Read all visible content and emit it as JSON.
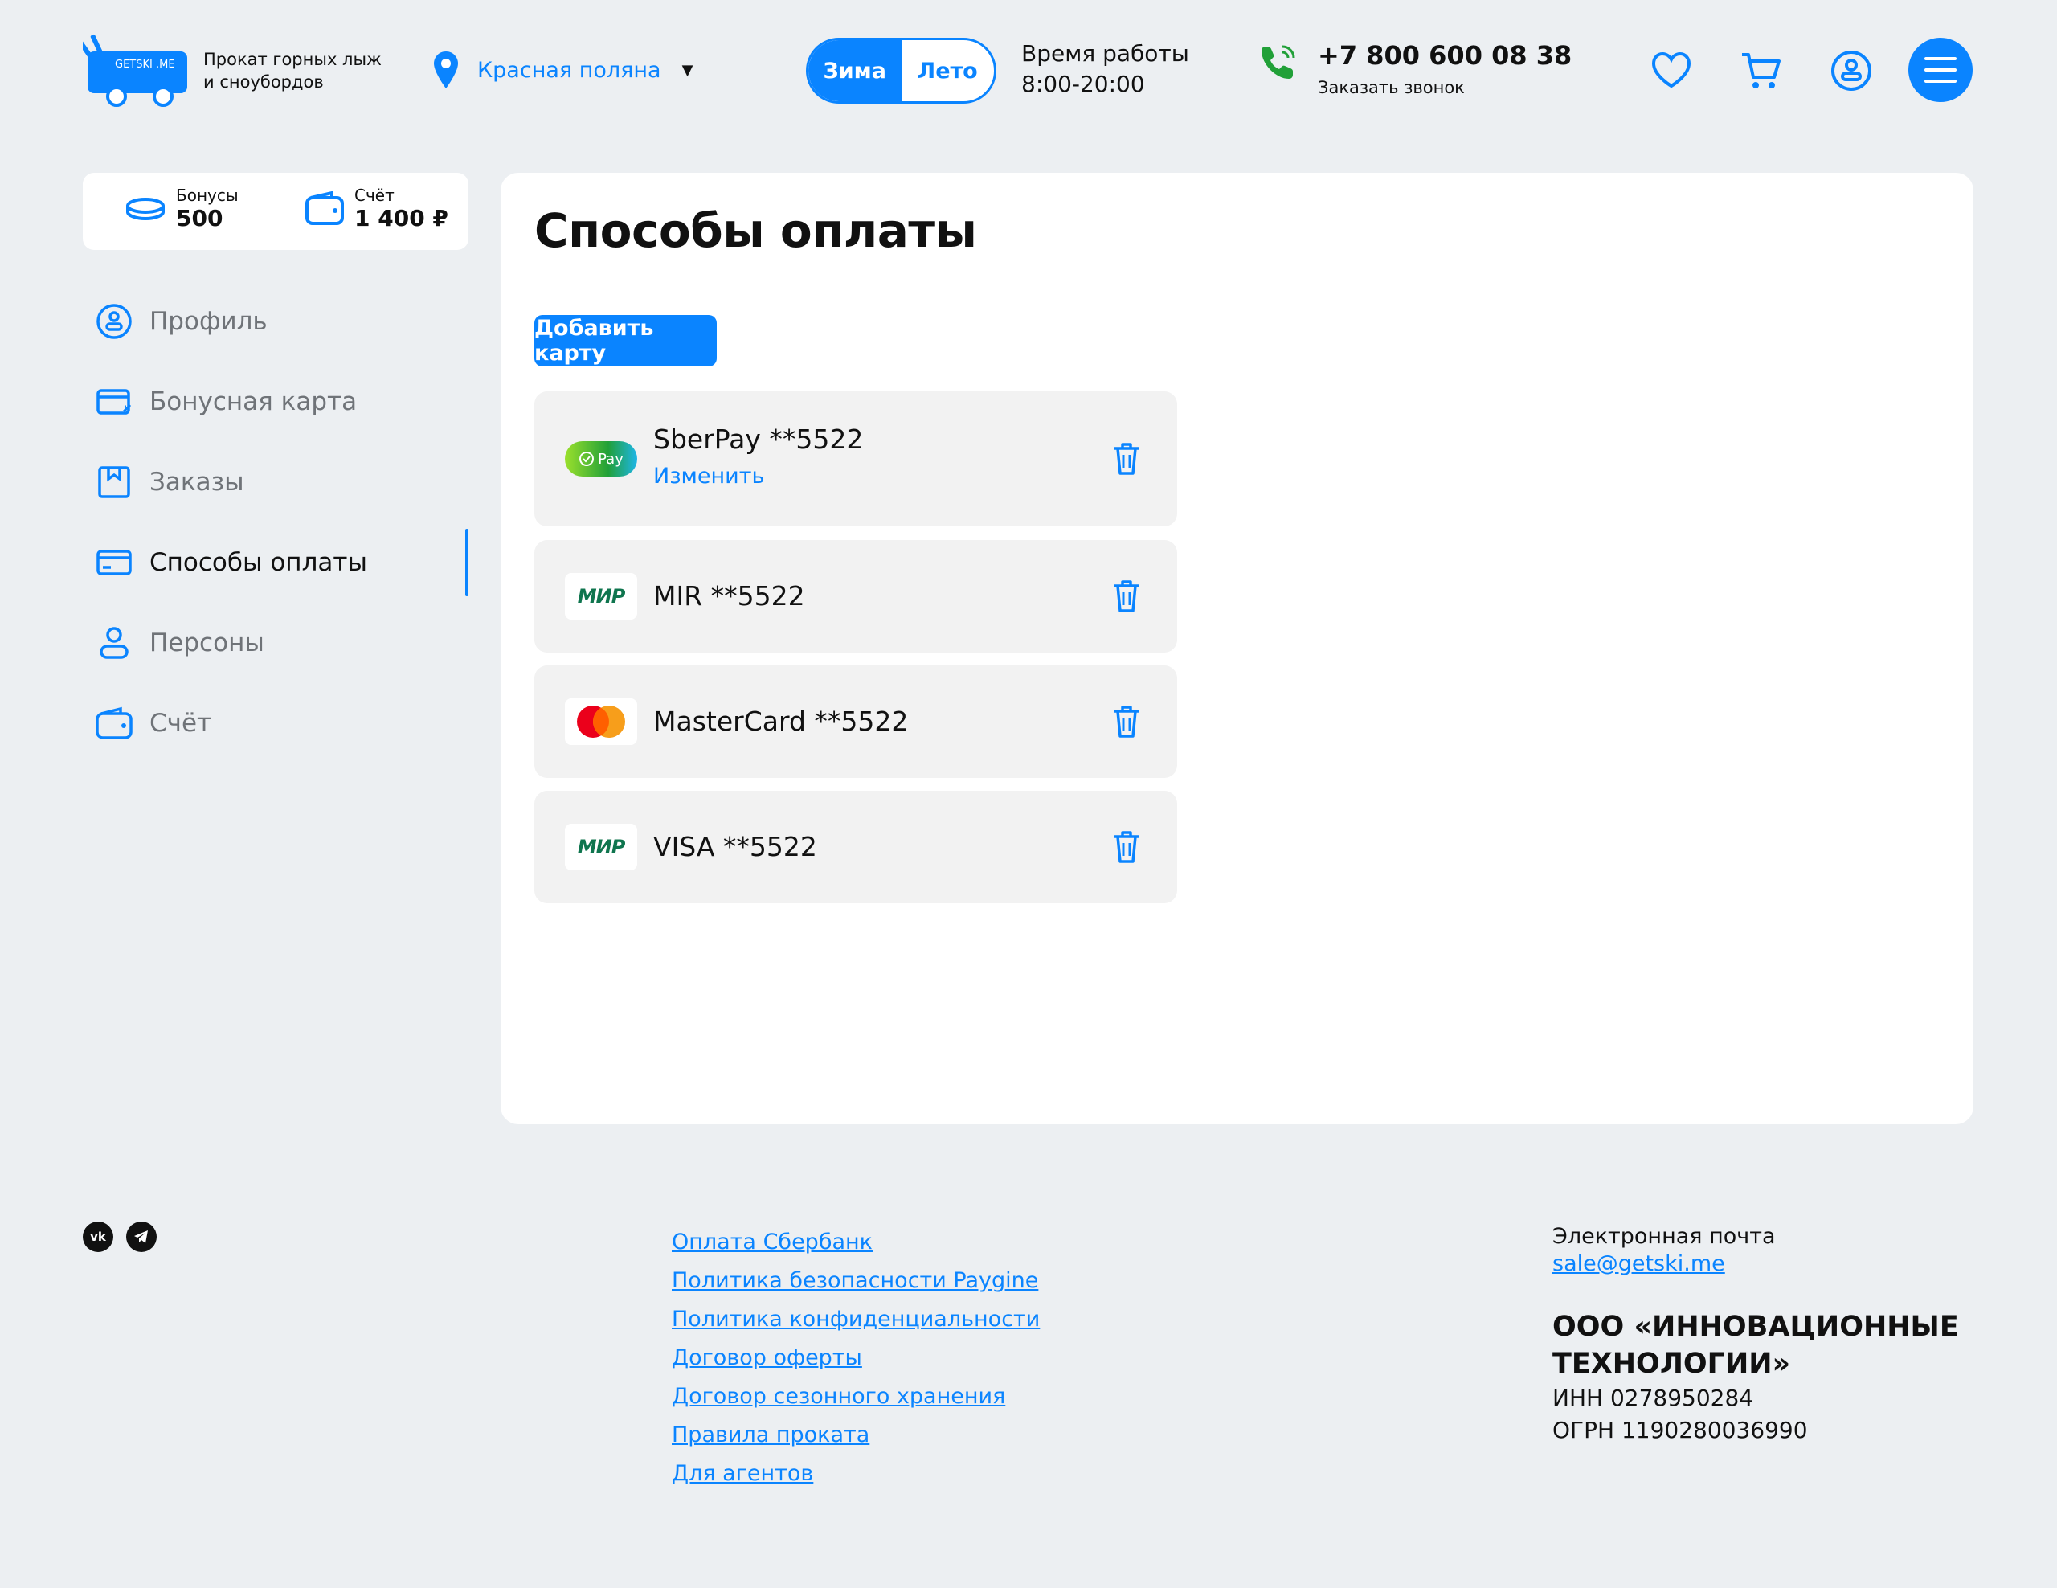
{
  "header": {
    "logo_text": "GETSKI .ME",
    "tagline_1": "Прокат горных лыж",
    "tagline_2": "и сноубордов",
    "city": "Красная поляна",
    "season_winter": "Зима",
    "season_summer": "Лето",
    "hours_label": "Время работы",
    "hours_value": "8:00-20:00",
    "phone": "+7 800 600 08 38",
    "callback": "Заказать звонок"
  },
  "wallet": {
    "bonus_label": "Бонусы",
    "bonus_value": "500",
    "account_label": "Счёт",
    "account_value": "1 400 ₽"
  },
  "sidebar": {
    "items": [
      {
        "label": "Профиль",
        "icon": "profile-icon"
      },
      {
        "label": "Бонусная карта",
        "icon": "bonus-card-icon"
      },
      {
        "label": "Заказы",
        "icon": "orders-icon"
      },
      {
        "label": "Способы оплаты",
        "icon": "payment-card-icon",
        "active": true
      },
      {
        "label": "Персоны",
        "icon": "person-icon"
      },
      {
        "label": "Счёт",
        "icon": "wallet-icon"
      }
    ]
  },
  "main": {
    "title": "Способы оплаты",
    "add_button": "Добавить карту",
    "methods": [
      {
        "name": "SberPay **5522",
        "edit": "Изменить",
        "logo": "Pay"
      },
      {
        "name": "MIR **5522",
        "logo": "МИР"
      },
      {
        "name": "MasterCard **5522"
      },
      {
        "name": "VISA **5522",
        "logo": "МИР"
      }
    ]
  },
  "footer": {
    "links": [
      "Оплата Сбербанк",
      "Политика безопасности Paygine",
      "Политика конфиденциальности",
      "Договор оферты",
      "Договор сезонного хранения",
      "Правила проката",
      "Для агентов"
    ],
    "email_label": "Электронная почта",
    "email": "sale@getski.me",
    "org_name": "ООО «ИННОВАЦИОННЫЕ ТЕХНОЛОГИИ»",
    "inn": "ИНН 0278950284",
    "ogrn": "ОГРН 1190280036990"
  },
  "colors": {
    "accent": "#0A84FF",
    "background": "#ECEFF2",
    "card": "#FFFFFF",
    "method_bg": "#F2F2F2",
    "mir_green": "#0F754E",
    "mc_red": "#EB001B",
    "mc_orange": "#F79E1B"
  }
}
